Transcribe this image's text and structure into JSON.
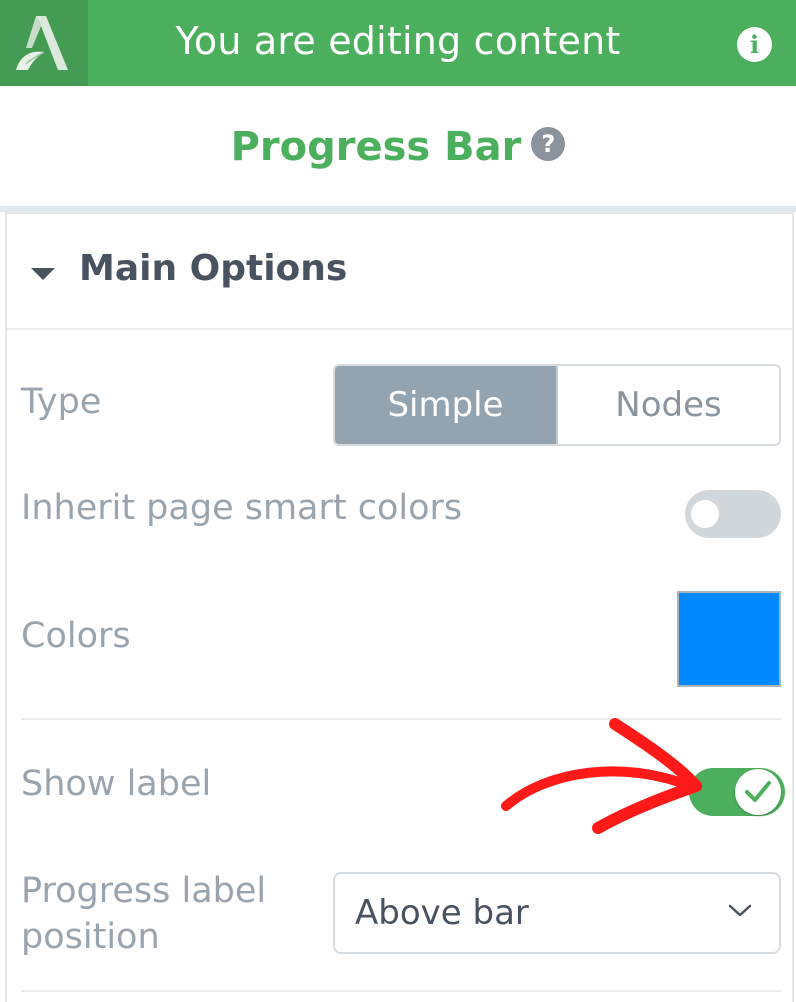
{
  "topbar": {
    "title": "You are editing content",
    "logo_icon": "app-logo-a",
    "info_icon": "info-icon",
    "bg_color": "#4caf5d"
  },
  "header": {
    "title": "Progress Bar",
    "help_icon_glyph": "?",
    "title_color": "#4caf5d"
  },
  "main_options": {
    "title": "Main Options",
    "type": {
      "label": "Type",
      "options": [
        "Simple",
        "Nodes"
      ],
      "selected": "Simple"
    },
    "inherit_colors": {
      "label": "Inherit page smart colors",
      "enabled": false
    },
    "colors": {
      "label": "Colors",
      "value": "#0089ff"
    },
    "show_label": {
      "label": "Show label",
      "enabled": true
    },
    "label_position": {
      "label_line1": "Progress label",
      "label_line2": "position",
      "value": "Above bar"
    }
  },
  "annotation": {
    "arrow_color": "#ff1a1a"
  }
}
